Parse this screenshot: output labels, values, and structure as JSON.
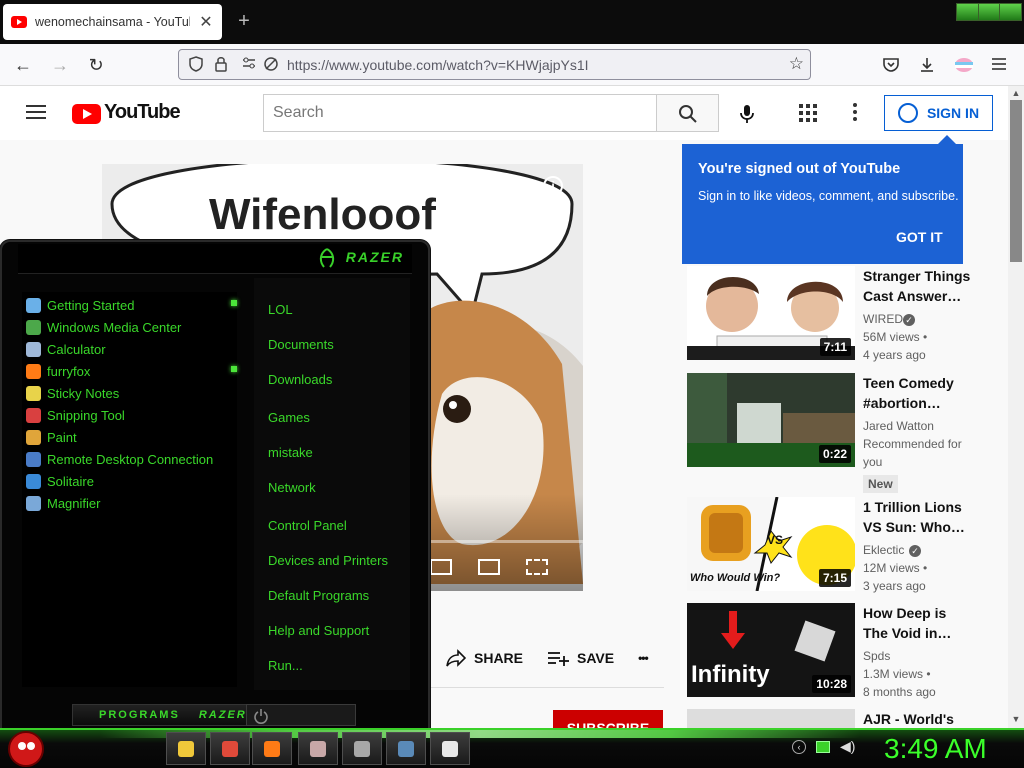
{
  "browser": {
    "tab_title": "wenomechainsama - YouTube",
    "tab_close": "✕",
    "new_tab": "+",
    "url": "https://www.youtube.com/watch?v=KHWjajpYs1I",
    "back": "←",
    "forward": "→",
    "reload": "↻",
    "star": "☆",
    "pocket_icon": "pocket-icon",
    "download_icon": "download-icon",
    "menu_icon": "hamburger-menu-icon"
  },
  "youtube": {
    "logo_text": "YouTube",
    "search_placeholder": "Search",
    "sign_in": "SIGN IN",
    "popup": {
      "title": "You're signed out of YouTube",
      "text": "Sign in to like videos, comment, and subscribe.",
      "got_it": "GOT IT"
    },
    "video": {
      "meme_text": "Wifenlooof",
      "info": "i"
    },
    "actions": {
      "share": "SHARE",
      "save": "SAVE",
      "more": "•••"
    },
    "subscribe": "SUBSCRIBE",
    "recommendations": [
      {
        "title": "Stranger Things Cast Answer…",
        "channel": "WIRED",
        "views": "56M views •",
        "age": "4 years ago",
        "duration": "7:11"
      },
      {
        "title": "Teen Comedy #abortion…",
        "channel": "Jared Watton",
        "views": "Recommended for you",
        "age": "",
        "duration": "0:22",
        "badge": "New"
      },
      {
        "title": "1 Trillion Lions VS Sun: Who…",
        "channel": "Eklectic",
        "views": "12M views •",
        "age": "3 years ago",
        "duration": "7:15"
      },
      {
        "title": "How Deep is The Void in…",
        "channel": "Spds",
        "views": "1.3M views •",
        "age": "8 months ago",
        "duration": "10:28"
      },
      {
        "title": "AJR - World's",
        "channel": "",
        "views": "",
        "age": "",
        "duration": ""
      }
    ],
    "thumb_text": {
      "lions_caption": "Who Would Win?",
      "lions_vs": "VS",
      "void_caption": "Infinity"
    }
  },
  "startmenu": {
    "logo": "RAZER",
    "programs": [
      {
        "label": "Getting Started",
        "color": "#6ab0e8"
      },
      {
        "label": "Windows Media Center",
        "color": "#4ca84a"
      },
      {
        "label": "Calculator",
        "color": "#9fb8d8"
      },
      {
        "label": "furryfox",
        "color": "#ff7b16"
      },
      {
        "label": "Sticky Notes",
        "color": "#e8d34a"
      },
      {
        "label": "Snipping Tool",
        "color": "#d94040"
      },
      {
        "label": "Paint",
        "color": "#e0a53a"
      },
      {
        "label": "Remote Desktop Connection",
        "color": "#4a7cc8"
      },
      {
        "label": "Solitaire",
        "color": "#3a8ad8"
      },
      {
        "label": "Magnifier",
        "color": "#7aa8d8"
      }
    ],
    "places": [
      "LOL",
      "Documents",
      "Downloads",
      "Games",
      "mistake",
      "Network",
      "Control Panel",
      "Devices and Printers",
      "Default Programs",
      "Help and Support",
      "Run..."
    ],
    "footer_programs": "PROGRAMS",
    "footer_razer": "RAZER"
  },
  "taskbar": {
    "clock": "3:49 AM",
    "apps": [
      {
        "name": "explorer",
        "color": "#f0c83a"
      },
      {
        "name": "chrome",
        "color": "#e04a3a"
      },
      {
        "name": "firefox",
        "color": "#ff7b16"
      },
      {
        "name": "app4",
        "color": "#c8a8a8"
      },
      {
        "name": "app5",
        "color": "#a8a8a8"
      },
      {
        "name": "app6",
        "color": "#5a8ab8"
      },
      {
        "name": "app7",
        "color": "#e8e8e8"
      }
    ]
  }
}
